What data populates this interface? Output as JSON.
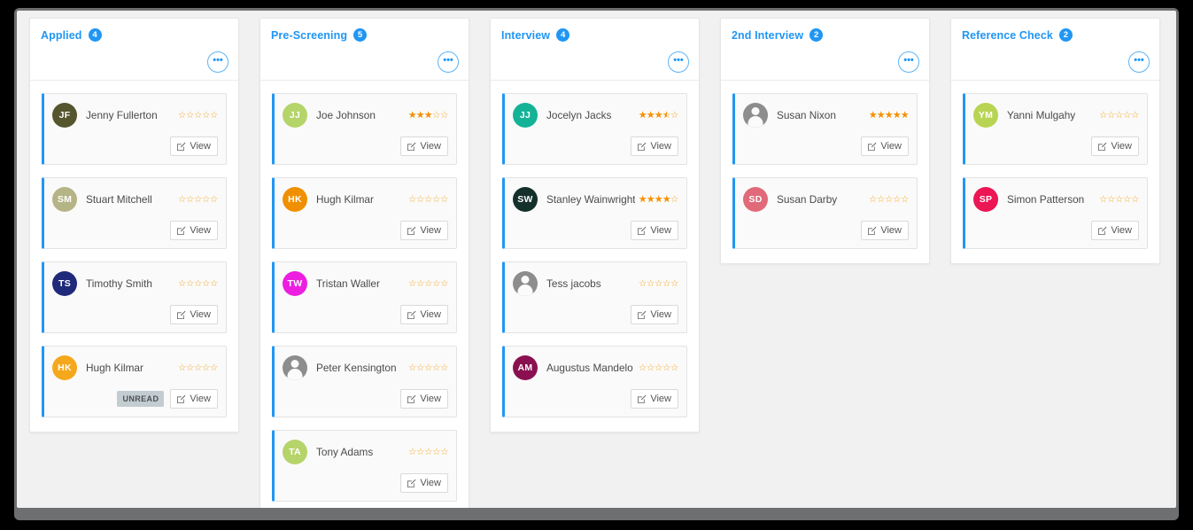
{
  "board": {
    "menu_glyph": "•••",
    "view_label": "View",
    "unread_label": "UNREAD",
    "accent_color": "#2196f3",
    "star_color": "#f5a623",
    "columns": [
      {
        "title": "Applied",
        "count": "4",
        "cards": [
          {
            "name": "Jenny Fullerton",
            "initials": "JF",
            "avatar_color": "#55552e",
            "rating": 0,
            "unread": false
          },
          {
            "name": "Stuart Mitchell",
            "initials": "SM",
            "avatar_color": "#b4b486",
            "rating": 0,
            "unread": false
          },
          {
            "name": "Timothy Smith",
            "initials": "TS",
            "avatar_color": "#1f2a7a",
            "rating": 0,
            "unread": false
          },
          {
            "name": "Hugh Kilmar",
            "initials": "HK",
            "avatar_color": "#f5a81c",
            "rating": 0,
            "unread": true
          }
        ]
      },
      {
        "title": "Pre-Screening",
        "count": "5",
        "cards": [
          {
            "name": "Joe Johnson",
            "initials": "JJ",
            "avatar_color": "#b5d469",
            "rating": 3,
            "unread": false
          },
          {
            "name": "Hugh Kilmar",
            "initials": "HK",
            "avatar_color": "#f09000",
            "rating": 0,
            "unread": false
          },
          {
            "name": "Tristan Waller",
            "initials": "TW",
            "avatar_color": "#ec1fe0",
            "rating": 0,
            "unread": false
          },
          {
            "name": "Peter Kensington",
            "initials": "",
            "avatar_color": "#8d8d8d",
            "rating": 0,
            "unread": false
          },
          {
            "name": "Tony Adams",
            "initials": "TA",
            "avatar_color": "#b5d469",
            "rating": 0,
            "unread": false
          }
        ]
      },
      {
        "title": "Interview",
        "count": "4",
        "cards": [
          {
            "name": "Jocelyn Jacks",
            "initials": "JJ",
            "avatar_color": "#14b398",
            "rating": 3.5,
            "unread": false
          },
          {
            "name": "Stanley Wainwright",
            "initials": "SW",
            "avatar_color": "#14302a",
            "rating": 4,
            "unread": false
          },
          {
            "name": "Tess jacobs",
            "initials": "",
            "avatar_color": "#8d8d8d",
            "rating": 0,
            "unread": false
          },
          {
            "name": "Augustus Mandelo",
            "initials": "AM",
            "avatar_color": "#8a1050",
            "rating": 0,
            "unread": false
          }
        ]
      },
      {
        "title": "2nd Interview",
        "count": "2",
        "cards": [
          {
            "name": "Susan Nixon",
            "initials": "",
            "avatar_color": "#8d8d8d",
            "rating": 5,
            "unread": false
          },
          {
            "name": "Susan Darby",
            "initials": "SD",
            "avatar_color": "#e06a7a",
            "rating": 0,
            "unread": false
          }
        ]
      },
      {
        "title": "Reference Check",
        "count": "2",
        "cards": [
          {
            "name": "Yanni Mulgahy",
            "initials": "YM",
            "avatar_color": "#b8d453",
            "rating": 0,
            "unread": false
          },
          {
            "name": "Simon Patterson",
            "initials": "SP",
            "avatar_color": "#ec1655",
            "rating": 0,
            "unread": false
          }
        ]
      }
    ]
  }
}
